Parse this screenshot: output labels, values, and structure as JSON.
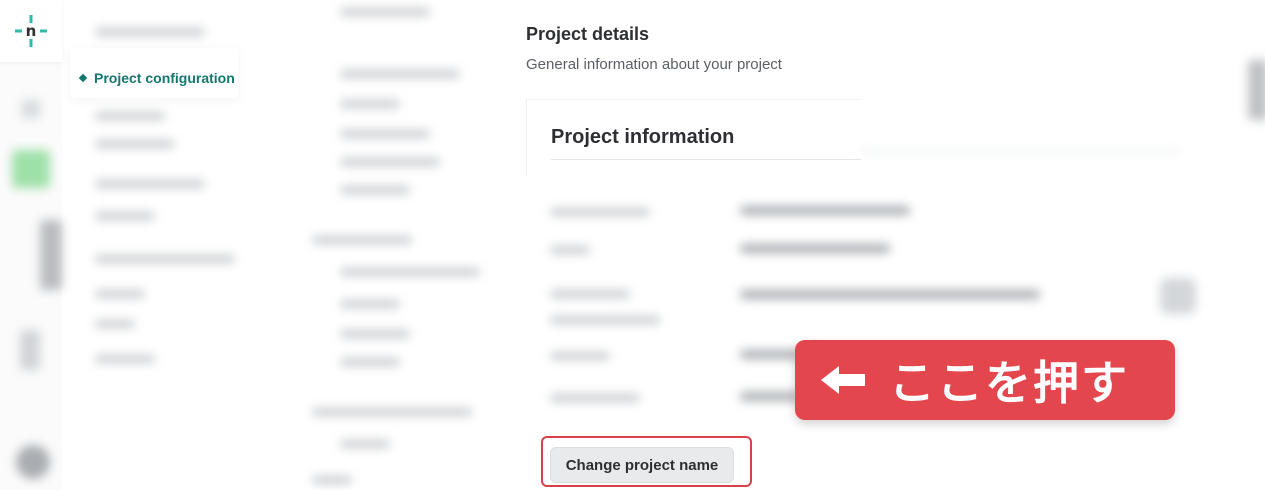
{
  "sidebar": {
    "active_item": "Project configuration"
  },
  "main": {
    "title": "Project details",
    "subtitle": "General information about your project",
    "card_title": "Project information",
    "change_name_button": "Change project name"
  },
  "callout": {
    "text": "ここを押す"
  },
  "colors": {
    "brand_teal": "#13776e",
    "logo_teal": "#32b9a8",
    "callout_red": "#e3464d",
    "highlight_red": "#d84149"
  },
  "icons": {
    "logo": "netlify-logo-icon",
    "callout_arrow": "arrow-left-icon",
    "nav_marker": "diamond-icon"
  }
}
